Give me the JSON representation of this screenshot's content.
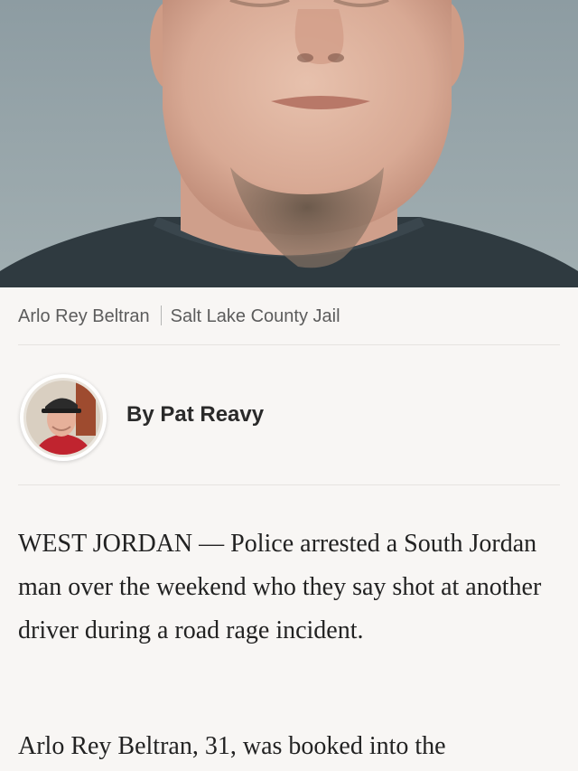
{
  "hero": {
    "image_name": "mugshot-photo"
  },
  "caption": {
    "subject": "Arlo Rey Beltran",
    "credit": "Salt Lake County Jail"
  },
  "byline": {
    "text": "By Pat Reavy",
    "avatar_name": "author-avatar"
  },
  "article": {
    "paragraphs": [
      "WEST JORDAN — Police arrested a South Jordan man over the weekend who they say shot at another driver during a road rage incident.",
      "Arlo Rey Beltran, 31, was booked into the"
    ]
  },
  "colors": {
    "background": "#f8f6f4",
    "caption_text": "#5c5c5c",
    "body_text": "#222222",
    "byline_text": "#2a2a2a"
  }
}
